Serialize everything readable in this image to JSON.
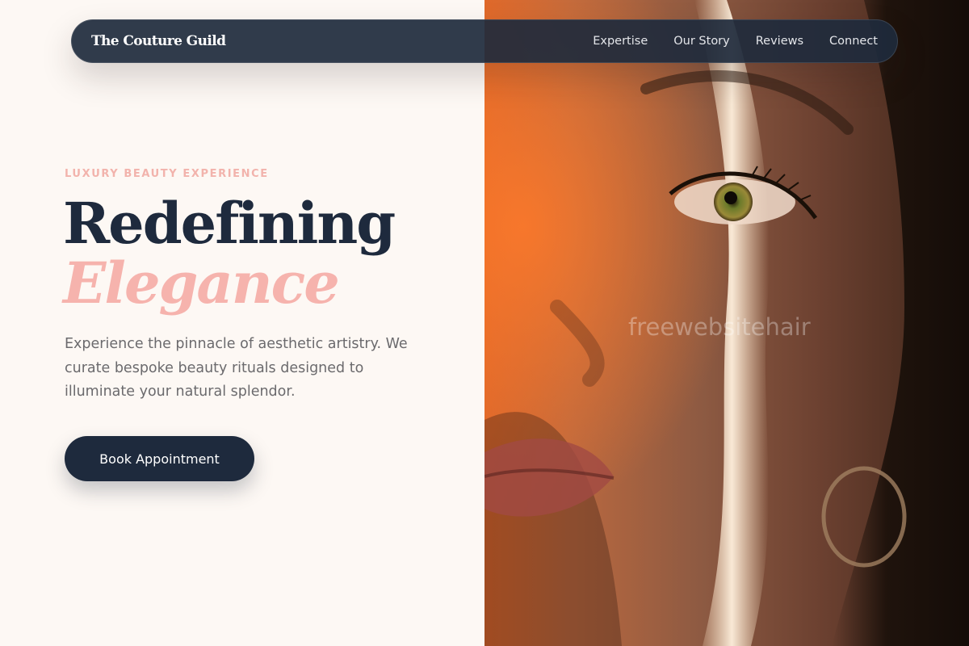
{
  "navbar": {
    "brand": "The Couture Guild",
    "links": [
      "Expertise",
      "Our Story",
      "Reviews",
      "Connect"
    ]
  },
  "hero": {
    "eyebrow": "LUXURY BEAUTY EXPERIENCE",
    "headline_line1": "Redefining",
    "headline_line2": "Elegance",
    "lede": "Experience the pinnacle of aesthetic artistry. We curate bespoke beauty rituals designed to illuminate your natural splendor.",
    "cta_label": "Book Appointment"
  },
  "watermark": "freewebsitehair",
  "colors": {
    "navy": "#1e2a3d",
    "blush": "#f6b3ad",
    "cream": "#fdf8f4",
    "text_muted": "#6b6a6d"
  }
}
